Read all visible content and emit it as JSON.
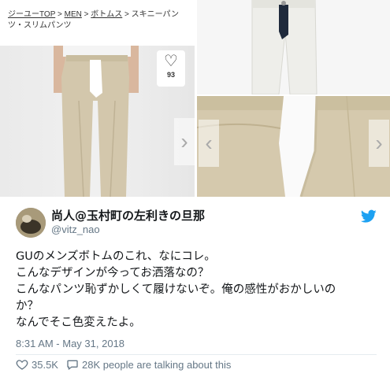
{
  "breadcrumb": {
    "items": [
      "ジーユーTOP",
      "MEN",
      "ボトムス",
      "スキニーパンツ・スリムパンツ"
    ],
    "separator": ">"
  },
  "favorites": {
    "count_1": "93",
    "count_2": "93"
  },
  "tweet": {
    "display_name": "尚人@玉村町の左利きの旦那",
    "handle": "@vitz_nao",
    "lines": [
      "GUのメンズボトムのこれ、なにコレ。",
      "こんなデザインが今ってお洒落なの？",
      "こんなパンツ恥ずかしくて履けないぞ。俺の感性がおかしいの",
      "か？",
      "なんでそこ色変えたよ。"
    ],
    "timestamp": "8:31 AM - May 31, 2018",
    "likes": "35.5K",
    "conversation": "28K people are talking about this"
  },
  "colors": {
    "twitter_blue": "#1da1f2",
    "khaki": "#d3c7ac",
    "white_pants": "#eeeeea"
  }
}
